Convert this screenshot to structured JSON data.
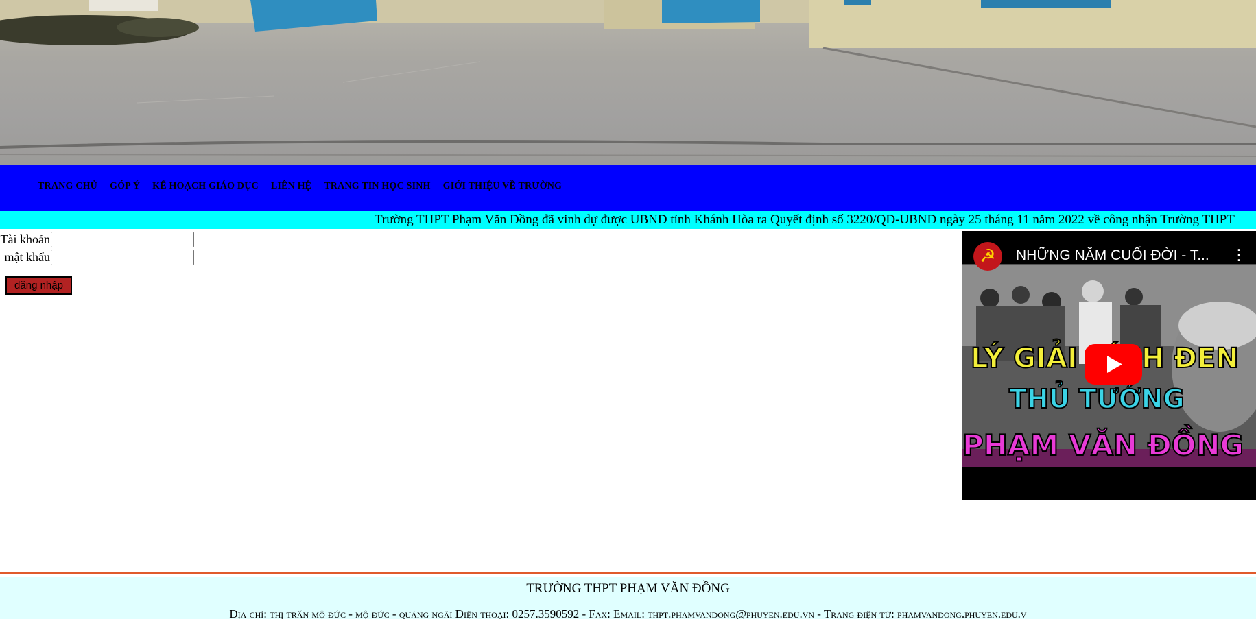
{
  "nav": {
    "items": [
      "Trang chủ",
      "Góp ý",
      "Kế hoạch giáo dục",
      "Liên hệ",
      "Trang tin học sinh",
      "Giới thiệu về trường"
    ]
  },
  "marquee": {
    "text": "Trường THPT Phạm Văn Đồng đã vinh dự được UBND tỉnh Khánh Hòa ra Quyết định số 3220/QĐ-UBND ngày 25 tháng 11 năm 2022 về công nhận Trường THPT"
  },
  "login": {
    "username_label": "Tài khoản",
    "password_label": "mật khẩu",
    "username_value": "",
    "password_value": "",
    "submit_label": "đăng nhập"
  },
  "video": {
    "title": "NHỮNG NĂM CUỐI ĐỜI - T...",
    "thumbnail_lines": [
      "LÝ GIẢI KÍNH ĐEN",
      "THỦ TƯỚNG",
      "PHẠM VĂN ĐỒNG"
    ]
  },
  "footer": {
    "school_name": "TRƯỜNG THPT PHẠM VĂN ĐỒNG",
    "address": "Địa chỉ: thị trấn mộ đức - mộ đức - quảng ngãi Điện thoại: 0257.3590592 - Fax: Email: thpt.phamvandong@phuyen.edu.vn - Trang điện tử: phamvandong.phuyen.edu.v"
  },
  "colors": {
    "nav_bg": "#0000ff",
    "marquee_bg": "#00ffff",
    "login_button_bg": "#b22222",
    "footer_bg": "#e0ffff",
    "footer_rule": "#e05a2b"
  }
}
